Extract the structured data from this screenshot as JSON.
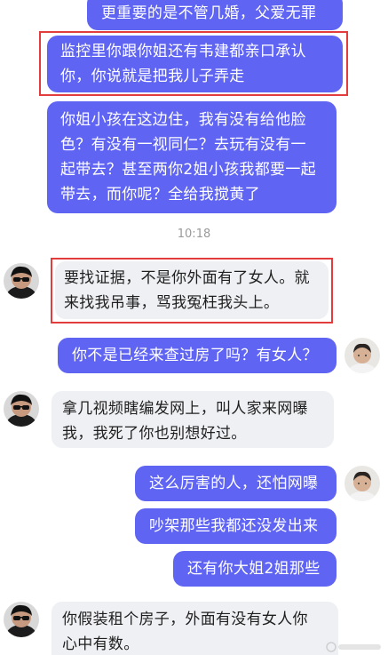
{
  "messages": [
    {
      "side": "out",
      "lines": [
        "更重要的是不管几婚，父爱无罪"
      ]
    },
    {
      "side": "out",
      "lines": [
        "监控里你跟你姐还有韦建都亲口承认",
        "你，你说就是把我儿子弄走"
      ]
    },
    {
      "side": "out",
      "lines": [
        "你姐小孩在这边住，我有没有给他脸",
        "色？有没有一视同仁？去玩有没有一",
        "起带去？甚至两你2姐小孩我都要一起",
        "带去，而你呢？全给我搅黄了"
      ]
    },
    {
      "side": "in",
      "lines": [
        "要找证据，不是你外面有了女人。就",
        "来找我吊事，骂我冤枉我头上。"
      ]
    },
    {
      "side": "out",
      "lines": [
        "你不是已经来查过房了吗？有女人？"
      ]
    },
    {
      "side": "in",
      "lines": [
        "拿几视频瞎编发网上，叫人家来网曝",
        "我，我死了你也别想好过。"
      ]
    },
    {
      "side": "out",
      "lines": [
        "这么厉害的人，还怕网曝"
      ]
    },
    {
      "side": "out",
      "lines": [
        "吵架那些我都还没发出来"
      ]
    },
    {
      "side": "out",
      "lines": [
        "还有你大姐2姐那些"
      ]
    },
    {
      "side": "in",
      "lines": [
        "你假装租个房子，外面有没有女人你",
        "心中有数。"
      ]
    }
  ],
  "timestamp": "10:18",
  "colors": {
    "outgoing_bubble": "#5f64f3",
    "incoming_bubble": "#eff0f3",
    "highlight_box": "#e23c3c"
  },
  "avatars": {
    "incoming": "sunglasses-person-avatar",
    "outgoing": "young-man-avatar"
  }
}
